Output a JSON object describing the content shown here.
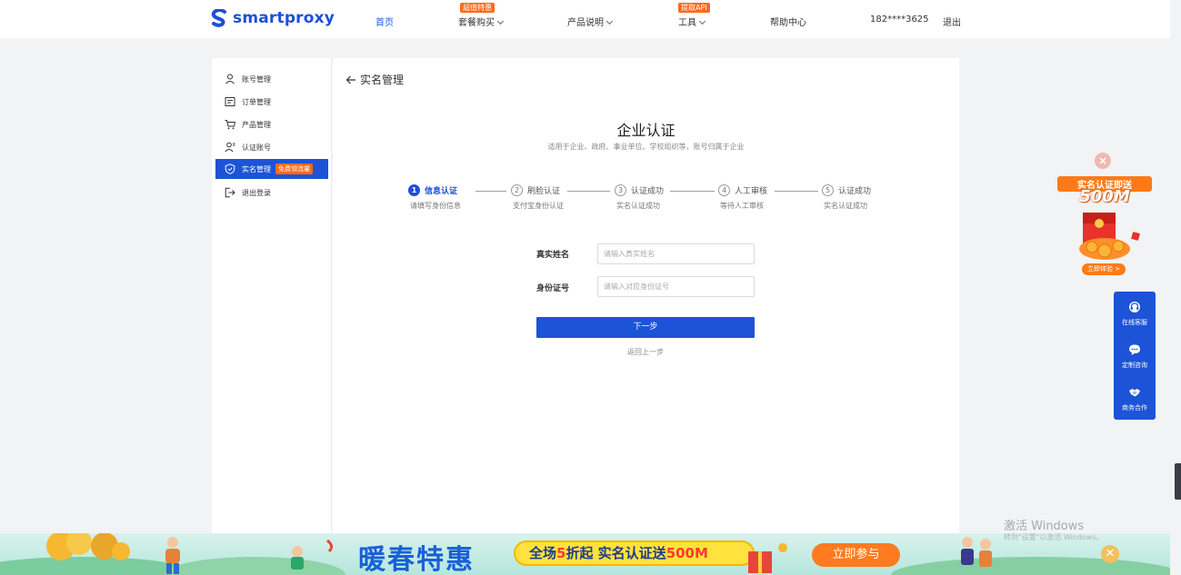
{
  "header": {
    "logo_text": "smartproxy",
    "nav": [
      {
        "label": "首页"
      },
      {
        "label": "套餐购买",
        "badge": "超值特惠"
      },
      {
        "label": "产品说明"
      },
      {
        "label": "工具",
        "badge": "提取API"
      },
      {
        "label": "帮助中心"
      }
    ],
    "user_phone": "182****3625",
    "logout": "退出"
  },
  "sidebar": {
    "items": [
      {
        "label": "账号管理",
        "icon": "user-icon"
      },
      {
        "label": "订单管理",
        "icon": "order-icon"
      },
      {
        "label": "产品管理",
        "icon": "cart-icon"
      },
      {
        "label": "认证账号",
        "icon": "users-icon"
      },
      {
        "label": "实名管理",
        "icon": "shield-icon",
        "badge": "免费领流量"
      },
      {
        "label": "退出登录",
        "icon": "logout-icon"
      }
    ]
  },
  "main": {
    "back_label": "实名管理",
    "title": "企业认证",
    "subtitle": "适用于企业、政府、事业单位、学校组织等，账号归属于企业",
    "steps": [
      {
        "num": "1",
        "label": "信息认证",
        "desc": "请填写身份信息"
      },
      {
        "num": "2",
        "label": "刷脸认证",
        "desc": "支付宝身份认证"
      },
      {
        "num": "3",
        "label": "认证成功",
        "desc": "实名认证成功"
      },
      {
        "num": "4",
        "label": "人工审核",
        "desc": "等待人工审核"
      },
      {
        "num": "5",
        "label": "认证成功",
        "desc": "实名认证成功"
      }
    ],
    "form": {
      "name_label": "真实姓名",
      "name_placeholder": "请输入真实姓名",
      "id_label": "身份证号",
      "id_placeholder": "请输入对应身份证号"
    },
    "next_button": "下一步",
    "prev_link": "返回上一步"
  },
  "promo": {
    "title": "实名认证即送",
    "size": "500M",
    "button": "立即体验 >"
  },
  "service": [
    {
      "label": "在线客服",
      "icon": "headset-icon"
    },
    {
      "label": "定制咨询",
      "icon": "chat-icon"
    },
    {
      "label": "商务合作",
      "icon": "handshake-icon"
    }
  ],
  "banner": {
    "title": "暖春特惠",
    "pill_a": "全场",
    "pill_b": "5",
    "pill_c": "折起  实名认证送",
    "pill_d": "500M",
    "cta": "立即参与",
    "close": "✕"
  },
  "windows": {
    "activate": "激活 Windows",
    "hint": "转到\"设置\"以激活 Windows。"
  },
  "colors": {
    "primary": "#1d53d6",
    "accent": "#ff6a1a"
  }
}
